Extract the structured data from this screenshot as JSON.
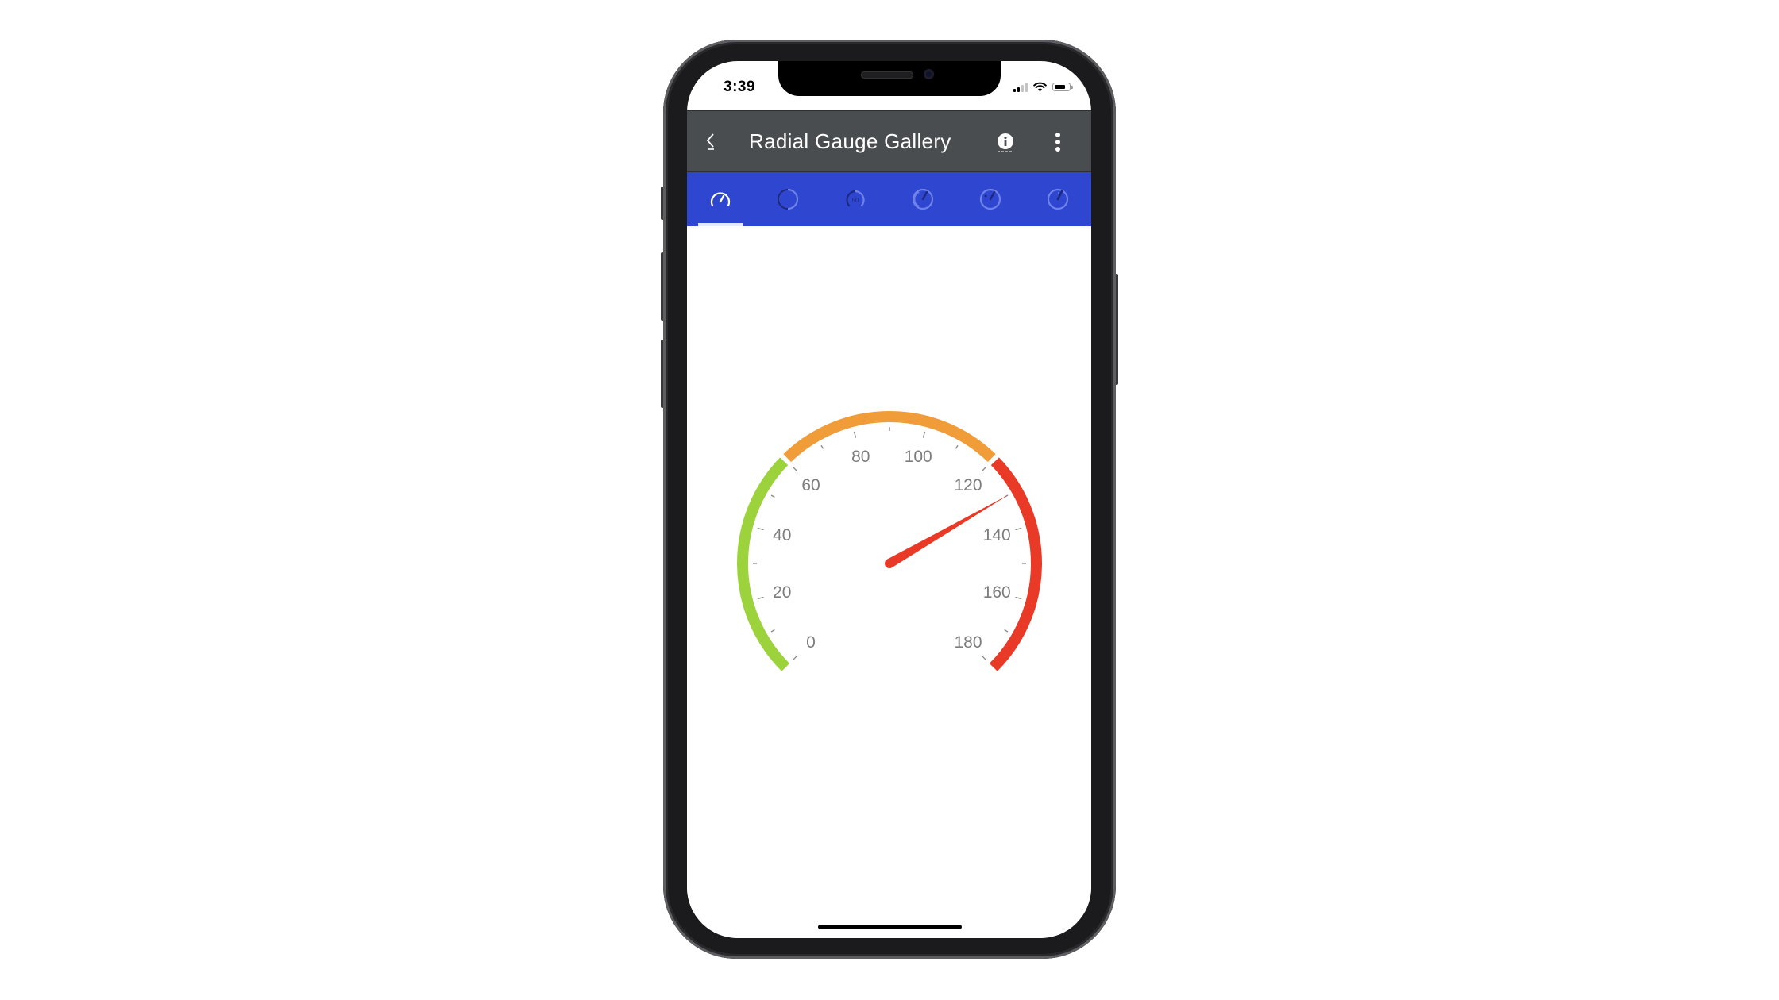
{
  "status_bar": {
    "time": "3:39",
    "signal_bars_active": 2,
    "signal_bars_total": 4,
    "wifi": "wifi-icon",
    "battery": "battery-icon"
  },
  "navbar": {
    "back_icon": "chevron-left-icon",
    "title": "Radial Gauge Gallery",
    "info_icon": "info-icon",
    "more_icon": "more-vertical-icon"
  },
  "tabs": [
    {
      "name": "speedometer",
      "icon": "speedometer-gauge-icon",
      "active": true
    },
    {
      "name": "ring",
      "icon": "ring-gauge-icon",
      "active": false
    },
    {
      "name": "labeled-arc",
      "icon": "labeled-arc-gauge-icon",
      "label": "50",
      "active": false
    },
    {
      "name": "needle-arc",
      "icon": "needle-arc-gauge-icon",
      "active": false
    },
    {
      "name": "needle-dot",
      "icon": "needle-dot-gauge-icon",
      "active": false
    },
    {
      "name": "needle-basic",
      "icon": "needle-gauge-icon",
      "active": false
    }
  ],
  "colors": {
    "navbar": "#4a4d50",
    "tabbar": "#2e46d0",
    "range_low": "#9cd33d",
    "range_mid": "#f09c38",
    "range_high": "#e83a26",
    "needle": "#e83a26",
    "label": "#7d7d7d"
  },
  "chart_data": {
    "type": "radial-gauge",
    "min": 0,
    "max": 180,
    "major_interval": 20,
    "minor_interval": 10,
    "tick_labels": [
      "0",
      "20",
      "40",
      "60",
      "80",
      "100",
      "120",
      "140",
      "160",
      "180"
    ],
    "start_angle_deg": 135,
    "sweep_angle_deg": 270,
    "ranges": [
      {
        "name": "low",
        "from": 0,
        "to": 60,
        "color": "#9cd33d"
      },
      {
        "name": "mid",
        "from": 60,
        "to": 120,
        "color": "#f09c38"
      },
      {
        "name": "high",
        "from": 120,
        "to": 180,
        "color": "#e83a26"
      }
    ],
    "needle_value": 130
  }
}
